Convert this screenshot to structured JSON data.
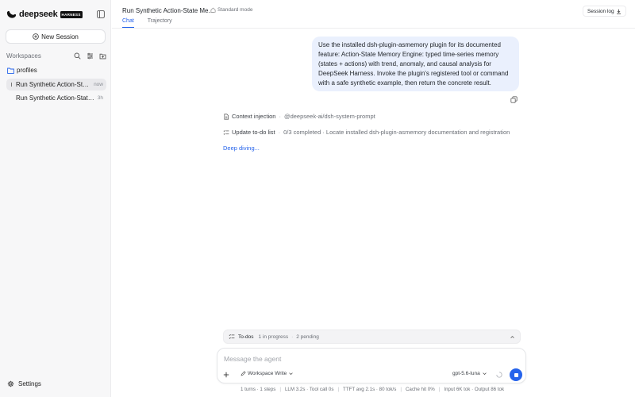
{
  "brand": {
    "name": "deepseek",
    "badge": "HARNESS"
  },
  "sidebar": {
    "new_session_label": "New Session",
    "workspaces_title": "Workspaces",
    "folder": "profiles",
    "sessions": [
      {
        "title": "Run Synthetic Action-State Memory Engine",
        "time": "now"
      },
      {
        "title": "Run Synthetic Action-State Memory Engine",
        "time": "3h"
      }
    ],
    "settings_label": "Settings"
  },
  "header": {
    "title": "Run Synthetic Action-State Me...",
    "mode": "Standard mode",
    "tabs": [
      {
        "label": "Chat",
        "active": true
      },
      {
        "label": "Trajectory",
        "active": false
      }
    ],
    "session_log_label": "Session log"
  },
  "chat": {
    "user_message": "Use the installed dsh-plugin-asmemory plugin for its documented feature: Action-State Memory Engine: typed time-series memory (states + actions) with trend, anomaly, and causal analysis for DeepSeek Harness. Invoke the plugin's registered tool or command with a safe synthetic example, then return the concrete result.",
    "steps": [
      {
        "name": "Context injection",
        "detail": "@deepseek-ai/dsh-system-prompt"
      },
      {
        "name": "Update to-do list",
        "detail": "0/3 completed · Locate installed dsh-plugin-asmemory documentation and registration"
      }
    ],
    "status": "Deep diving..."
  },
  "todos": {
    "label": "To-dos",
    "in_progress": "1 in progress",
    "pending": "2 pending"
  },
  "composer": {
    "placeholder": "Message the agent",
    "workspace_mode": "Workspace Write",
    "model": "gpt-5.6-luna"
  },
  "status_bar": [
    "1 turns · 1 steps",
    "LLM 3.2s · Tool call 0s",
    "TTFT avg 2.1s · 80 tok/s",
    "Cache hit 0%",
    "Input 6K tok · Output 86 tok"
  ],
  "colors": {
    "accent": "#2563eb",
    "bubble": "#eaf0fd",
    "sidebar": "#f7f7f8"
  }
}
